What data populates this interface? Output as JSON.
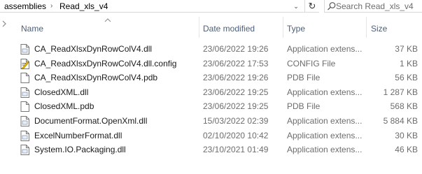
{
  "address_bar": {
    "breadcrumbs": [
      "assemblies",
      "Read_xls_v4"
    ],
    "separator": "›",
    "dropdown_glyph": "⌄",
    "refresh_glyph": "↻",
    "refresh_icon": "refresh-icon"
  },
  "search": {
    "placeholder": "Search Read_xls_v4",
    "icon": "search-icon"
  },
  "columns": {
    "name": "Name",
    "date": "Date modified",
    "type": "Type",
    "size": "Size",
    "sort_indicator": "sort-ascending-icon"
  },
  "files": [
    {
      "name": "CA_ReadXlsxDynRowColV4.dll",
      "date": "23/06/2022 19:26",
      "type": "Application extens...",
      "size": "37 KB",
      "icon": "dll-file-icon"
    },
    {
      "name": "CA_ReadXlsxDynRowColV4.dll.config",
      "date": "23/06/2022 17:53",
      "type": "CONFIG File",
      "size": "1 KB",
      "icon": "config-file-icon"
    },
    {
      "name": "CA_ReadXlsxDynRowColV4.pdb",
      "date": "23/06/2022 19:26",
      "type": "PDB File",
      "size": "56 KB",
      "icon": "pdb-file-icon"
    },
    {
      "name": "ClosedXML.dll",
      "date": "23/06/2022 19:25",
      "type": "Application extens...",
      "size": "1 287 KB",
      "icon": "dll-file-icon"
    },
    {
      "name": "ClosedXML.pdb",
      "date": "23/06/2022 19:25",
      "type": "PDB File",
      "size": "568 KB",
      "icon": "pdb-file-icon"
    },
    {
      "name": "DocumentFormat.OpenXml.dll",
      "date": "15/03/2022 02:39",
      "type": "Application extens...",
      "size": "5 884 KB",
      "icon": "dll-file-icon"
    },
    {
      "name": "ExcelNumberFormat.dll",
      "date": "02/10/2020 10:42",
      "type": "Application extens...",
      "size": "30 KB",
      "icon": "dll-file-icon"
    },
    {
      "name": "System.IO.Packaging.dll",
      "date": "23/10/2021 01:49",
      "type": "Application extens...",
      "size": "46 KB",
      "icon": "dll-file-icon"
    }
  ],
  "colors": {
    "header_text": "#4c607a",
    "muted_text": "#6d6d6d",
    "divider": "#e5e5e5"
  }
}
